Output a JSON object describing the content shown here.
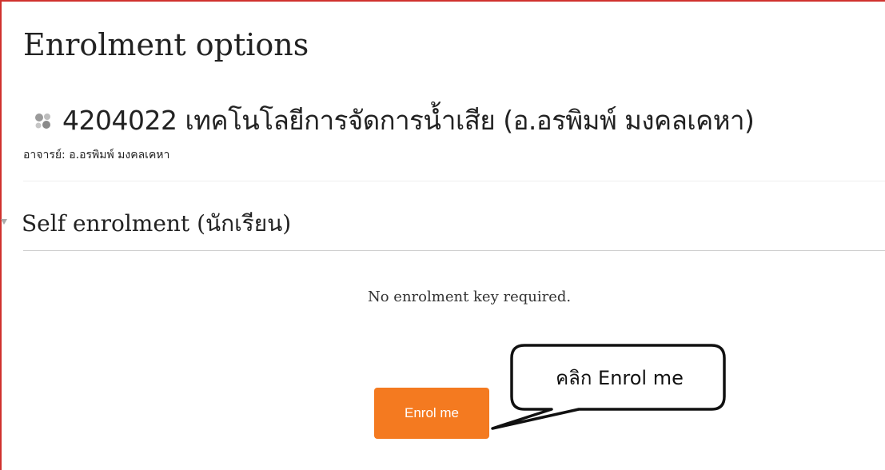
{
  "page": {
    "title": "Enrolment options"
  },
  "course": {
    "icon": "course-puzzle-icon",
    "title": "4204022 เทคโนโลยีการจัดการน้ำเสีย (อ.อรพิมพ์ มงคลเคหา)",
    "teacher_line": "อาจารย์: อ.อรพิมพ์ มงคลเคหา"
  },
  "self_enrolment": {
    "toggle_icon": "collapse-triangle-icon",
    "section_title": "Self enrolment (นักเรียน)",
    "key_note": "No enrolment key required.",
    "enrol_button_label": "Enrol me"
  },
  "annotation": {
    "callout_text": "คลิก Enrol me"
  },
  "colors": {
    "frame_border": "#d0312d",
    "enrol_button": "#f47a20",
    "icon_grey": "#9a9a9a"
  }
}
